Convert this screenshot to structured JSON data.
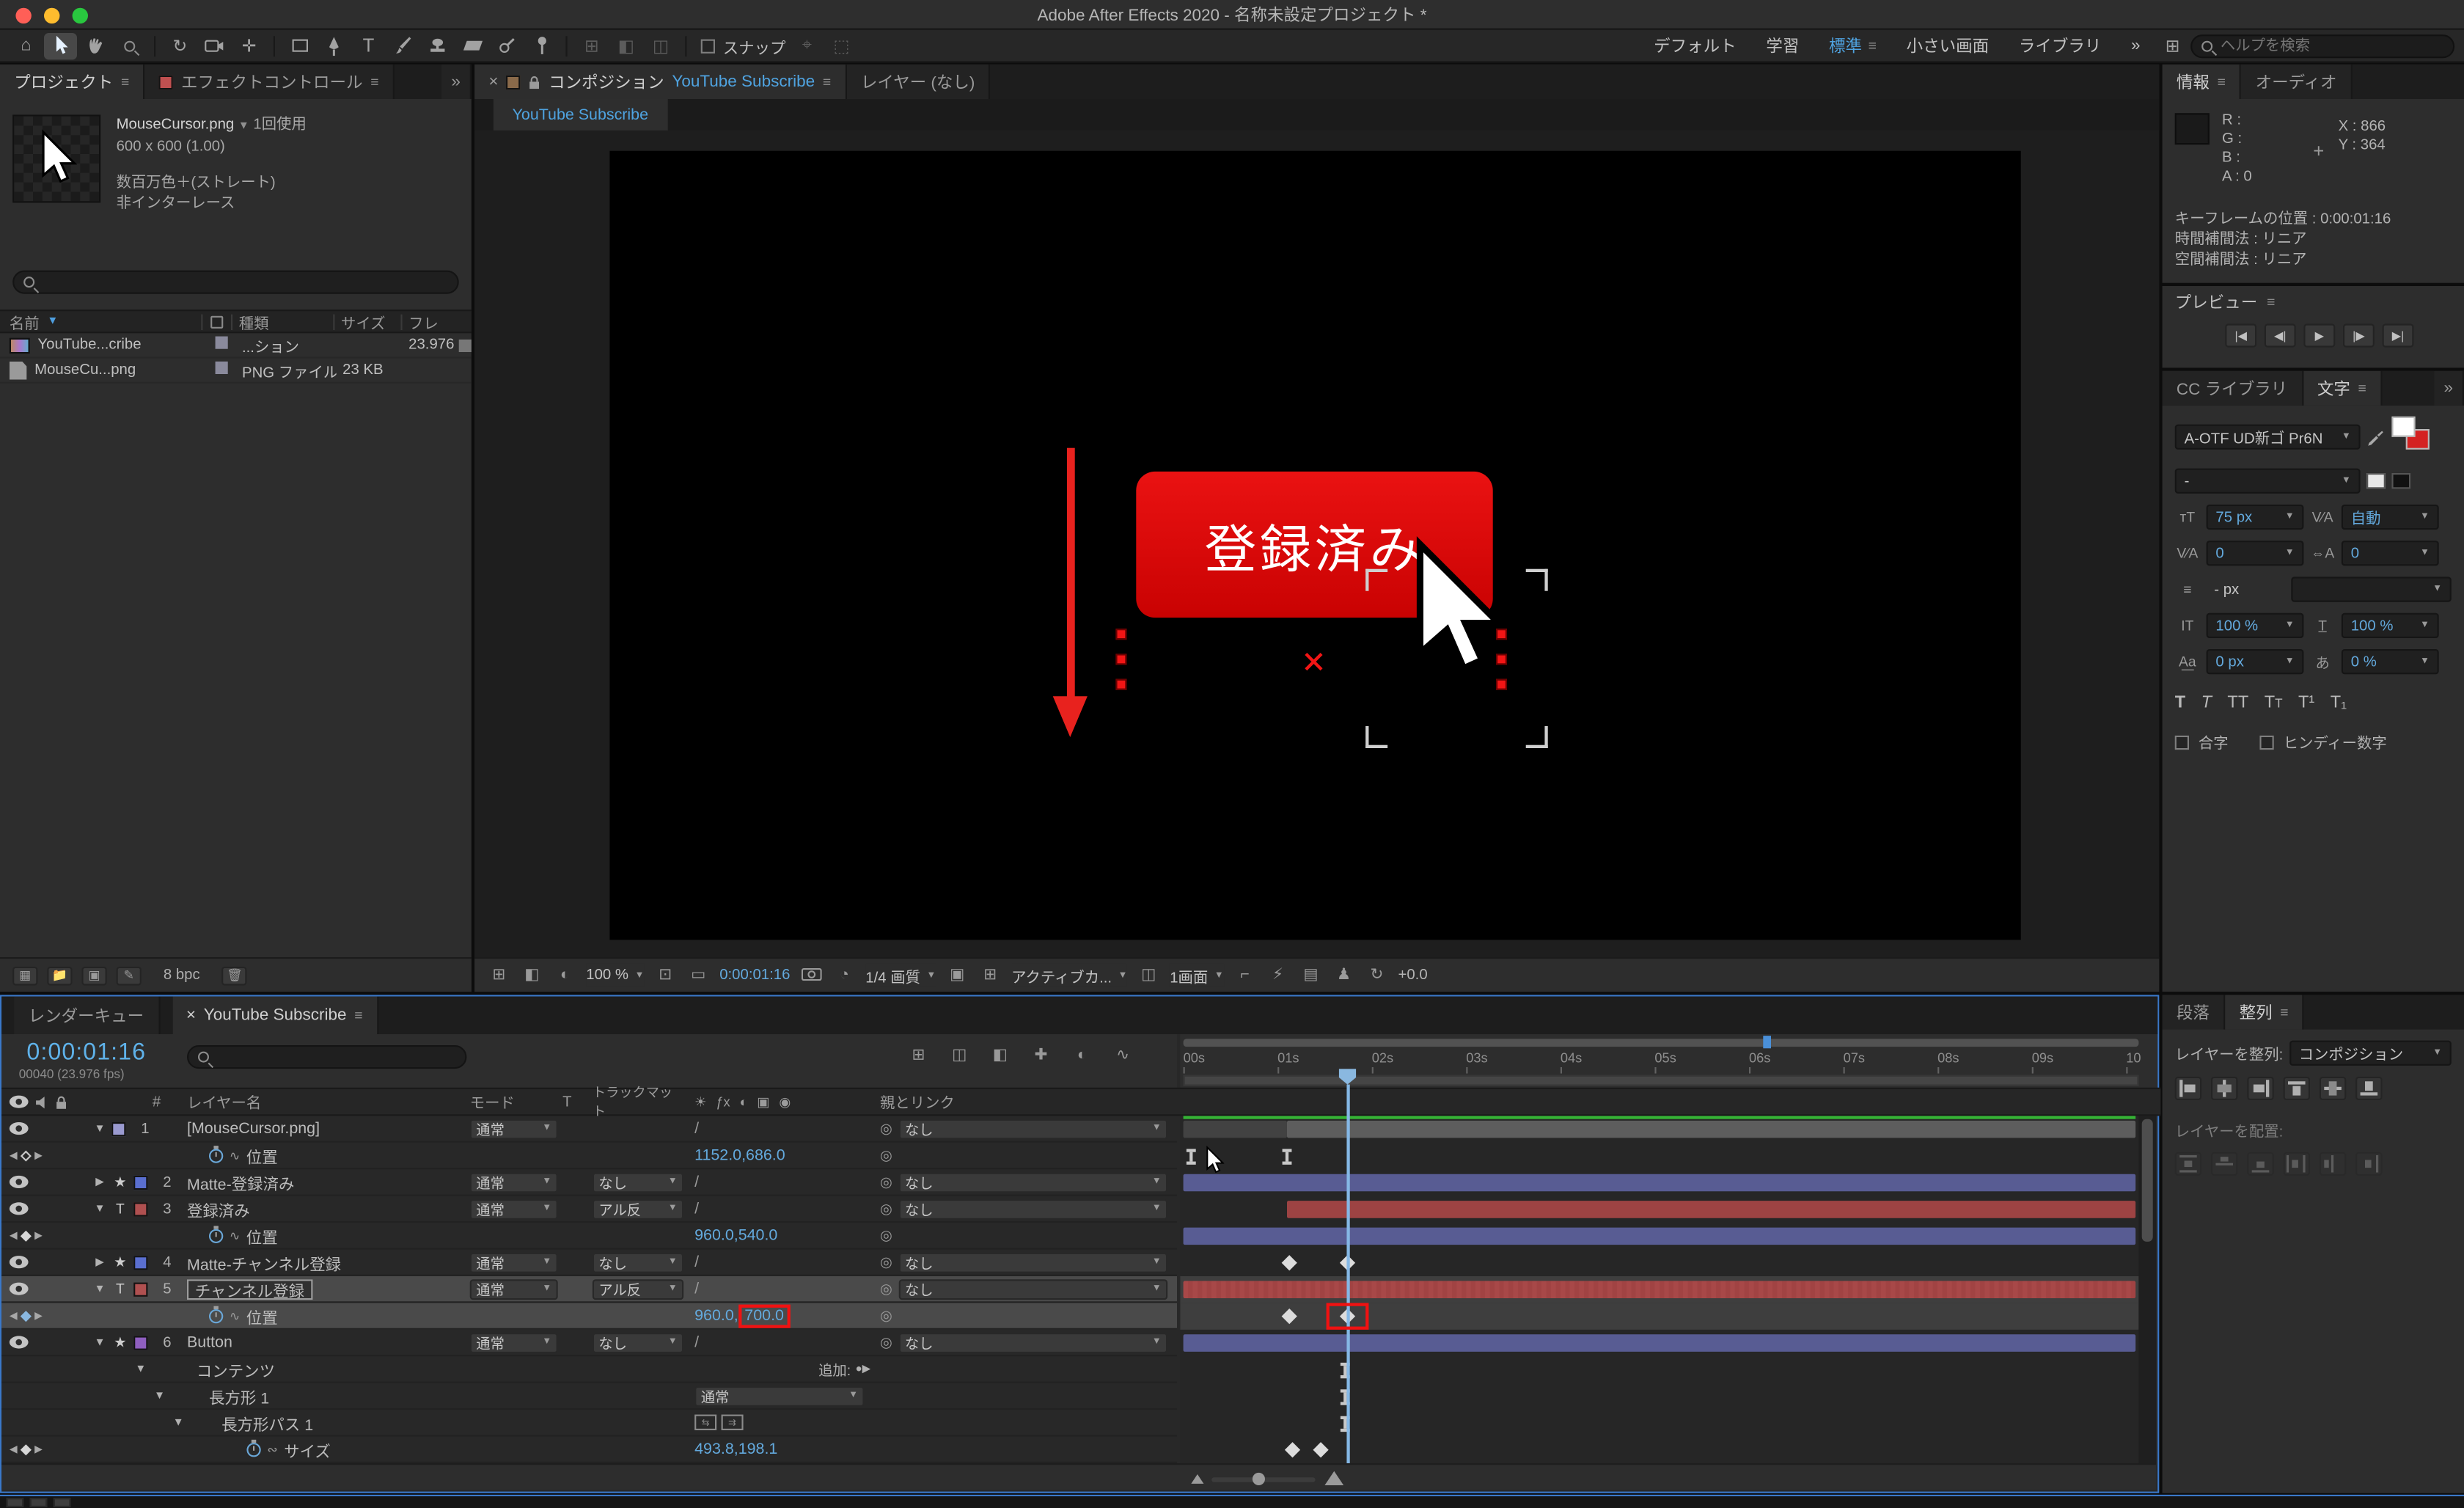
{
  "titlebar": {
    "title": "Adobe After Effects 2020 - 名称未設定プロジェクト *"
  },
  "toolbar": {
    "snap_label": "スナップ",
    "workspaces": {
      "default": "デフォルト",
      "learn": "学習",
      "standard": "標準",
      "small_screen": "小さい画面",
      "libraries": "ライブラリ"
    },
    "overflow": "»",
    "search_placeholder": "ヘルプを検索"
  },
  "project_panel": {
    "tab_project": "プロジェクト",
    "tab_effect_controls": "エフェクトコントロール",
    "preview": {
      "name": "MouseCursor.png",
      "usage": "1回使用",
      "dimensions": "600 x 600 (1.00)",
      "color_depth": "数百万色＋(ストレート)",
      "interlace": "非インターレース"
    },
    "columns": {
      "name": "名前",
      "type": "種類",
      "size": "サイズ",
      "fps": "フレ"
    },
    "rows": [
      {
        "name": "YouTube...cribe",
        "type": "...ション",
        "size": "",
        "fps": "23.976"
      },
      {
        "name": "MouseCu...png",
        "type": "PNG ファイル",
        "size": "23 KB",
        "fps": ""
      }
    ],
    "footer_bpc": "8 bpc"
  },
  "comp_panel": {
    "close": "×",
    "tab_label": "コンポジション",
    "tab_comp_name": "YouTube Subscribe",
    "tab_layer": "レイヤー (なし)",
    "viewer_tab": "YouTube Subscribe",
    "canvas": {
      "button_label": "登録済み"
    },
    "footer": {
      "zoom": "100 %",
      "timecode": "0:00:01:16",
      "resolution": "1/4 画質",
      "camera": "アクティブカ...",
      "view_layout": "1画面",
      "exposure": "+0.0"
    }
  },
  "info_panel": {
    "tab_info": "情報",
    "tab_audio": "オーディオ",
    "r": "R :",
    "g": "G :",
    "b": "B :",
    "a": "A :  0",
    "x": "X :  866",
    "y": "Y :  364",
    "keyframe_line": "キーフレームの位置 : 0:00:01:16",
    "temporal_line": "時間補間法 : リニア",
    "spatial_line": "空間補間法 : リニア"
  },
  "preview_panel": {
    "title": "プレビュー"
  },
  "character_panel": {
    "tab_libraries": "CC ライブラリ",
    "tab_character": "文字",
    "overflow": "»",
    "font_family": "A-OTF UD新ゴ Pr6N",
    "font_style": "-",
    "font_size": "75 px",
    "kerning": "自動",
    "tracking_left": "0",
    "tracking_right": "0",
    "line_unit": "- px",
    "vertical_scale": "100 %",
    "horizontal_scale": "100 %",
    "baseline_shift": "0 px",
    "tsume": "0 %",
    "ligatures_label": "合字",
    "hindi_label": "ヒンディー数字"
  },
  "align_panel": {
    "tab_paragraph": "段落",
    "tab_align": "整列",
    "align_label": "レイヤーを整列:",
    "align_target": "コンポジション",
    "distribute_label": "レイヤーを配置:"
  },
  "timeline": {
    "tab_render_queue": "レンダーキュー",
    "tab_close": "×",
    "tab_comp": "YouTube Subscribe",
    "timecode": "0:00:01:16",
    "frame_info": "00040 (23.976 fps)",
    "columns": {
      "num": "#",
      "layer_name": "レイヤー名",
      "mode": "モード",
      "t": "T",
      "track_matte": "トラックマット",
      "parent": "親とリンク"
    },
    "ruler": [
      "00s",
      "01s",
      "02s",
      "03s",
      "04s",
      "05s",
      "06s",
      "07s",
      "08s",
      "09s",
      "10"
    ],
    "layers": [
      {
        "num": "1",
        "name": "[MouseCursor.png]",
        "mode": "通常",
        "matte": "",
        "parent": "なし"
      },
      {
        "num": "2",
        "name": "Matte-登録済み",
        "mode": "通常",
        "matte": "なし",
        "parent": "なし"
      },
      {
        "num": "3",
        "name": "登録済み",
        "mode": "通常",
        "matte": "アル反",
        "parent": "なし"
      },
      {
        "num": "4",
        "name": "Matte-チャンネル登録",
        "mode": "通常",
        "matte": "なし",
        "parent": "なし"
      },
      {
        "num": "5",
        "name": "チャンネル登録",
        "mode": "通常",
        "matte": "アル反",
        "parent": "なし"
      },
      {
        "num": "6",
        "name": "Button",
        "mode": "通常",
        "matte": "なし",
        "parent": "なし"
      }
    ],
    "props": {
      "position_label": "位置",
      "pos1": "1152.0,686.0",
      "pos3": "960.0,540.0",
      "pos5_x": "960.0,",
      "pos5_y": "700.0",
      "contents_label": "コンテンツ",
      "add_label": "追加:",
      "rect_name": "長方形 1",
      "rect_mode": "通常",
      "rect_path_name": "長方形パス 1",
      "size_label": "サイズ",
      "size_value": "493.8,198.1"
    }
  }
}
